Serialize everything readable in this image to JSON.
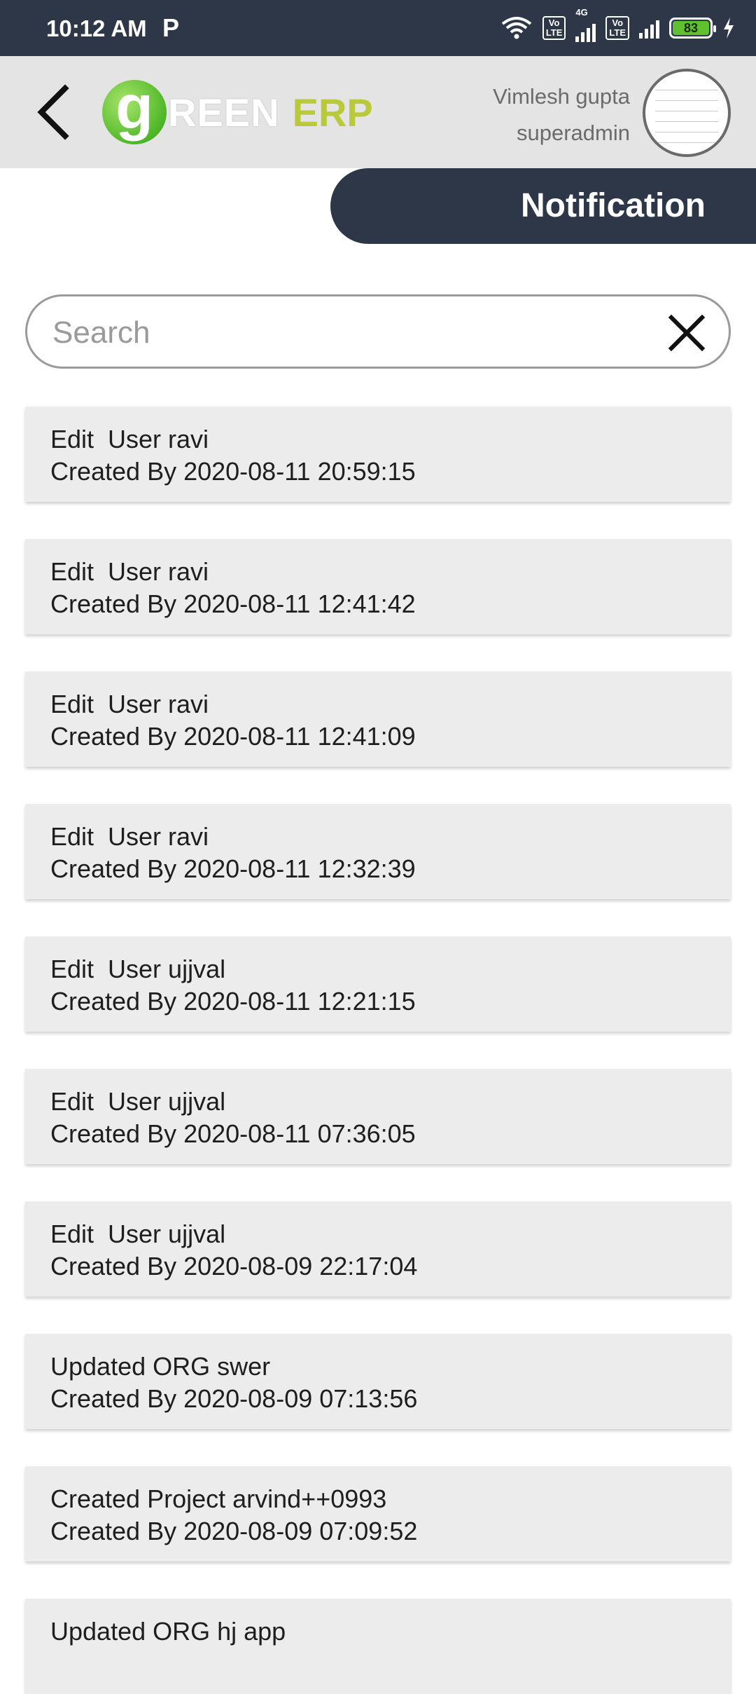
{
  "status_bar": {
    "time": "10:12 AM",
    "carrier_icon_text": "P",
    "network_type": "4G",
    "volte1": "Vo\nLTE",
    "volte2": "Vo\nLTE",
    "battery": "83"
  },
  "header": {
    "logo_g": "g",
    "logo_reen": "REEN",
    "logo_erp": "ERP",
    "user_name": "Vimlesh gupta",
    "user_role": "superadmin"
  },
  "page": {
    "title": "Notification"
  },
  "search": {
    "placeholder": "Search",
    "value": ""
  },
  "notifications": [
    {
      "action": "Edit  User ravi",
      "created": "Created By 2020-08-11 20:59:15"
    },
    {
      "action": "Edit  User ravi",
      "created": "Created By 2020-08-11 12:41:42"
    },
    {
      "action": "Edit  User ravi",
      "created": "Created By 2020-08-11 12:41:09"
    },
    {
      "action": "Edit  User ravi",
      "created": "Created By 2020-08-11 12:32:39"
    },
    {
      "action": "Edit  User ujjval",
      "created": "Created By 2020-08-11 12:21:15"
    },
    {
      "action": "Edit  User ujjval",
      "created": "Created By 2020-08-11 07:36:05"
    },
    {
      "action": "Edit  User ujjval",
      "created": "Created By 2020-08-09 22:17:04"
    },
    {
      "action": "Updated ORG swer",
      "created": "Created By 2020-08-09 07:13:56"
    },
    {
      "action": "Created Project arvind++0993",
      "created": "Created By 2020-08-09 07:09:52"
    },
    {
      "action": "Updated ORG hj app",
      "created": ""
    }
  ],
  "colors": {
    "header_dark": "#2d3748",
    "header_light": "#e4e4e4",
    "card_bg": "#ececec",
    "logo_green": "#4fb829",
    "logo_erp": "#b9c93a"
  },
  "icons": {
    "back": "chevron-left-icon",
    "clear": "close-icon",
    "wifi": "wifi-icon",
    "signal": "signal-icon",
    "battery": "battery-icon",
    "charging": "bolt-icon"
  }
}
